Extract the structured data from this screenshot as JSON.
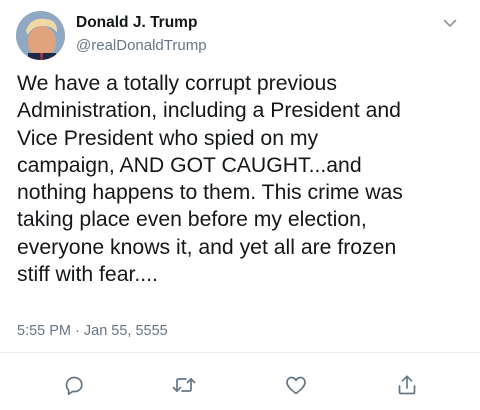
{
  "author": {
    "display_name": "Donald J. Trump",
    "handle": "@realDonaldTrump",
    "avatar_icon": "profile-photo"
  },
  "tweet": {
    "text": "We have a totally corrupt previous\nAdministration, including a President and\nVice President who spied on my\ncampaign, AND GOT CAUGHT...and\nnothing happens to them. This crime was\ntaking place even before my election,\neveryone knows it, and yet all are frozen\nstiff with fear....",
    "timestamp": "5:55 PM · Jan 55, 5555"
  },
  "actions": [
    {
      "name": "reply",
      "icon": "reply-icon"
    },
    {
      "name": "retweet",
      "icon": "retweet-icon"
    },
    {
      "name": "like",
      "icon": "heart-icon"
    },
    {
      "name": "share",
      "icon": "share-icon"
    }
  ],
  "menu": {
    "icon": "chevron-down-icon"
  },
  "colors": {
    "text_primary": "#14171a",
    "text_secondary": "#657786",
    "icon_gray": "#657786",
    "divider": "#e6ecf0"
  }
}
